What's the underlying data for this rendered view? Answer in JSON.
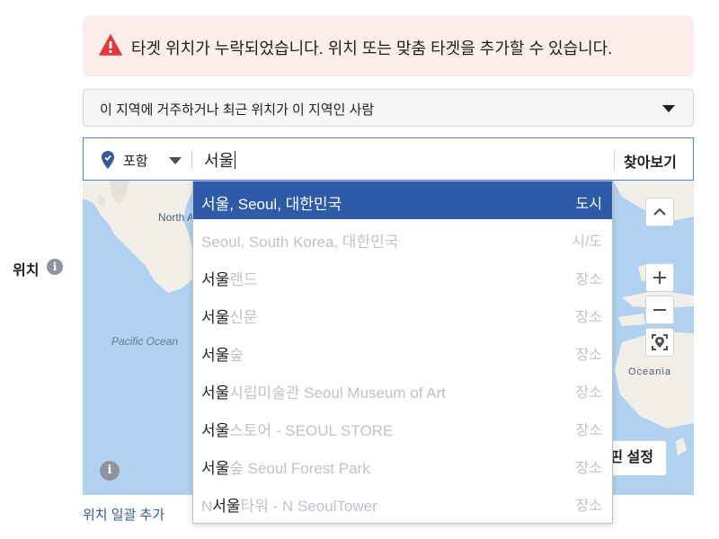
{
  "warning": {
    "text": "타겟 위치가 누락되었습니다. 위치 또는 맞춤 타겟을 추가할 수 있습니다.",
    "icon": "warning-triangle-icon",
    "color": "#e0393e"
  },
  "audience_select": {
    "value": "이 지역에 거주하거나 최근 위치가 이 지역인 사람"
  },
  "location": {
    "label": "위치",
    "info_glyph": "i"
  },
  "search": {
    "include_label": "포함",
    "query": "서울",
    "browse_label": "찾아보기"
  },
  "map": {
    "labels": {
      "north_america": "North Americ",
      "pacific_ocean": "Pacific Ocean",
      "oceania": "Oceania"
    },
    "pin_button": "핀 설정",
    "info_glyph": "i",
    "water_color": "#b1d1f0",
    "land_color": "#f2efe9"
  },
  "dropdown": {
    "items": [
      {
        "highlight": "서울, Seoul, 대한민국",
        "rest": "",
        "prefix": "",
        "type": "도시",
        "selected": true
      },
      {
        "highlight": "",
        "rest": "Seoul, South Korea, 대한민국",
        "prefix": "",
        "type": "시/도",
        "selected": false
      },
      {
        "highlight": "서울",
        "rest": "랜드",
        "prefix": "",
        "type": "장소",
        "selected": false
      },
      {
        "highlight": "서울",
        "rest": "신문",
        "prefix": "",
        "type": "장소",
        "selected": false
      },
      {
        "highlight": "서울",
        "rest": "숲",
        "prefix": "",
        "type": "장소",
        "selected": false
      },
      {
        "highlight": "서울",
        "rest": "시립미술관 Seoul Museum of Art",
        "prefix": "",
        "type": "장소",
        "selected": false
      },
      {
        "highlight": "서울",
        "rest": "스토어 - SEOUL STORE",
        "prefix": "",
        "type": "장소",
        "selected": false
      },
      {
        "highlight": "서울",
        "rest": "숲 Seoul Forest Park",
        "prefix": "",
        "type": "장소",
        "selected": false
      },
      {
        "highlight": "서울",
        "rest": "타워 - N SeoulTower",
        "prefix": "N",
        "type": "장소",
        "selected": false
      }
    ],
    "selected_color": "#2f5aa8"
  },
  "bulk_add_link": "위치 일괄 추가"
}
